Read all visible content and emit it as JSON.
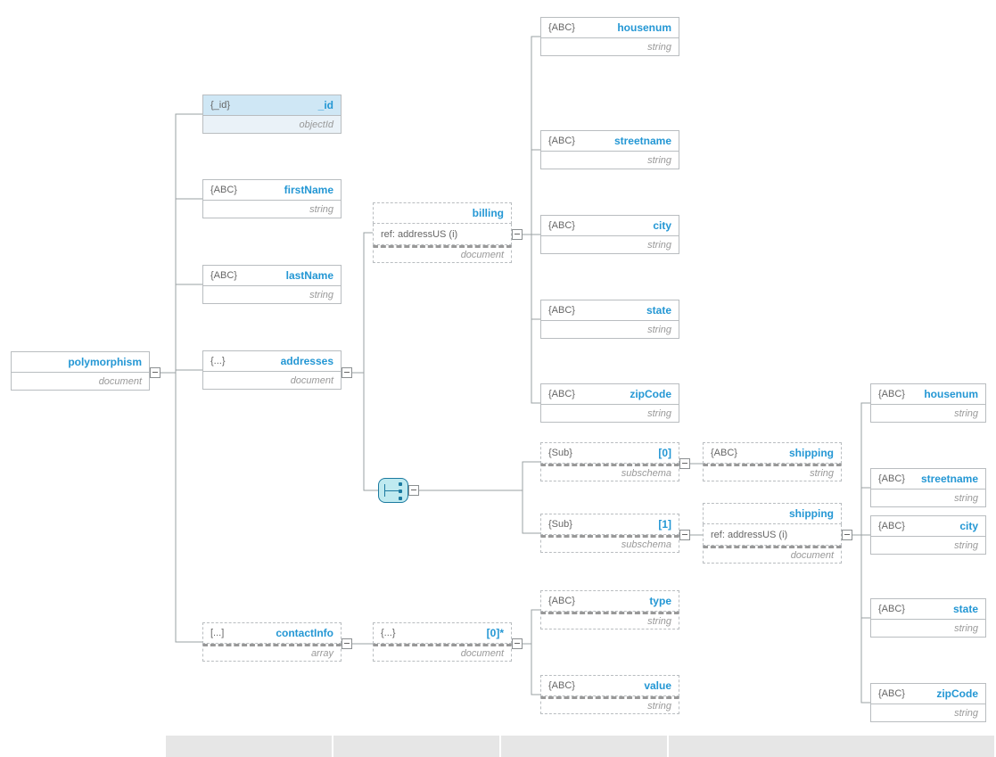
{
  "root": {
    "tag": "",
    "name": "polymorphism",
    "type": "document"
  },
  "id": {
    "tag": "{_id}",
    "name": "_id",
    "type": "objectId"
  },
  "fn": {
    "tag": "{ABC}",
    "name": "firstName",
    "type": "string"
  },
  "ln": {
    "tag": "{ABC}",
    "name": "lastName",
    "type": "string"
  },
  "addr": {
    "tag": "{...}",
    "name": "addresses",
    "type": "document"
  },
  "ci": {
    "tag": "[...]",
    "name": "contactInfo",
    "type": "array"
  },
  "billing": {
    "name": "billing",
    "ref": "ref:    addressUS (i)",
    "type": "document"
  },
  "ci0": {
    "tag": "{...}",
    "name": "[0]*",
    "type": "document"
  },
  "hnum": {
    "tag": "{ABC}",
    "name": "housenum",
    "type": "string"
  },
  "street": {
    "tag": "{ABC}",
    "name": "streetname",
    "type": "string"
  },
  "city": {
    "tag": "{ABC}",
    "name": "city",
    "type": "string"
  },
  "state": {
    "tag": "{ABC}",
    "name": "state",
    "type": "string"
  },
  "zip": {
    "tag": "{ABC}",
    "name": "zipCode",
    "type": "string"
  },
  "sub0": {
    "tag": "{Sub}",
    "name": "[0]",
    "type": "subschema"
  },
  "sub1": {
    "tag": "{Sub}",
    "name": "[1]",
    "type": "subschema"
  },
  "ctype": {
    "tag": "{ABC}",
    "name": "type",
    "type": "string"
  },
  "cval": {
    "tag": "{ABC}",
    "name": "value",
    "type": "string"
  },
  "ship0": {
    "tag": "{ABC}",
    "name": "shipping",
    "type": "string"
  },
  "ship1": {
    "name": "shipping",
    "ref": "ref:    addressUS (i)",
    "type": "document"
  },
  "hnum2": {
    "tag": "{ABC}",
    "name": "housenum",
    "type": "string"
  },
  "street2": {
    "tag": "{ABC}",
    "name": "streetname",
    "type": "string"
  },
  "city2": {
    "tag": "{ABC}",
    "name": "city",
    "type": "string"
  },
  "state2": {
    "tag": "{ABC}",
    "name": "state",
    "type": "string"
  },
  "zip2": {
    "tag": "{ABC}",
    "name": "zipCode",
    "type": "string"
  }
}
